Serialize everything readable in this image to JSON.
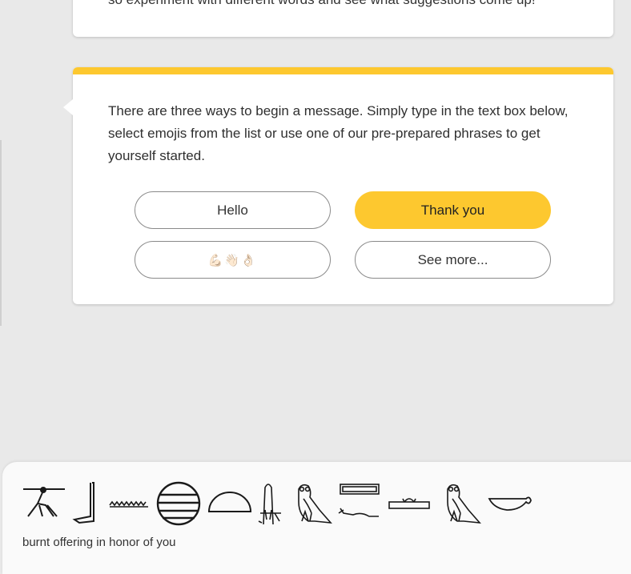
{
  "previous_card": {
    "text": "so experiment with different words and see what suggestions come up!"
  },
  "message_card": {
    "intro": "There are three ways to begin a message. Simply type in the text box below, select emojis from the list or use one of our pre-prepared phrases to get yourself started.",
    "buttons": {
      "hello": "Hello",
      "thank_you": "Thank you",
      "emojis": "💪🏼👋🏼👌🏼",
      "see_more": "See more..."
    }
  },
  "hieroglyph_panel": {
    "glyphs": [
      "person-arms-stretched-glyph",
      "leg-glyph",
      "water-ripple-glyph",
      "sun-disk-glyph",
      "bread-loaf-glyph",
      "reed-bundle-glyph",
      "owl-glyph",
      "pool-glyph",
      "offering-mat-glyph",
      "owl-glyph",
      "basket-glyph"
    ],
    "caption": "burnt offering in honor of you"
  },
  "colors": {
    "accent": "#fdc82f",
    "background": "#e9e9e9",
    "card": "#ffffff"
  }
}
